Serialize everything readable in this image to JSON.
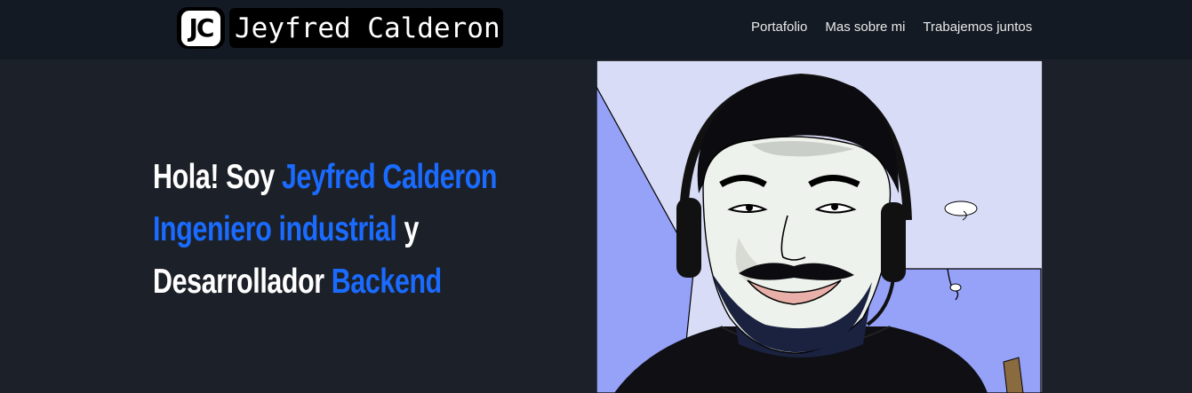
{
  "navbar": {
    "logo_initials": "JC",
    "brand_name": "Jeyfred Calderon",
    "links": [
      {
        "label": "Portafolio"
      },
      {
        "label": "Mas sobre mi"
      },
      {
        "label": "Trabajemos juntos"
      }
    ]
  },
  "hero": {
    "line1_prefix": "Hola! Soy ",
    "line1_name": "Jeyfred Calderon",
    "line2_role": "Ingeniero industrial",
    "line2_connector": " y",
    "line3_prefix": "Desarrollador ",
    "line3_role": "Backend"
  },
  "colors": {
    "background": "#1c2028",
    "navbar": "#141a23",
    "highlight": "#1a6bff",
    "text": "#ffffff"
  }
}
